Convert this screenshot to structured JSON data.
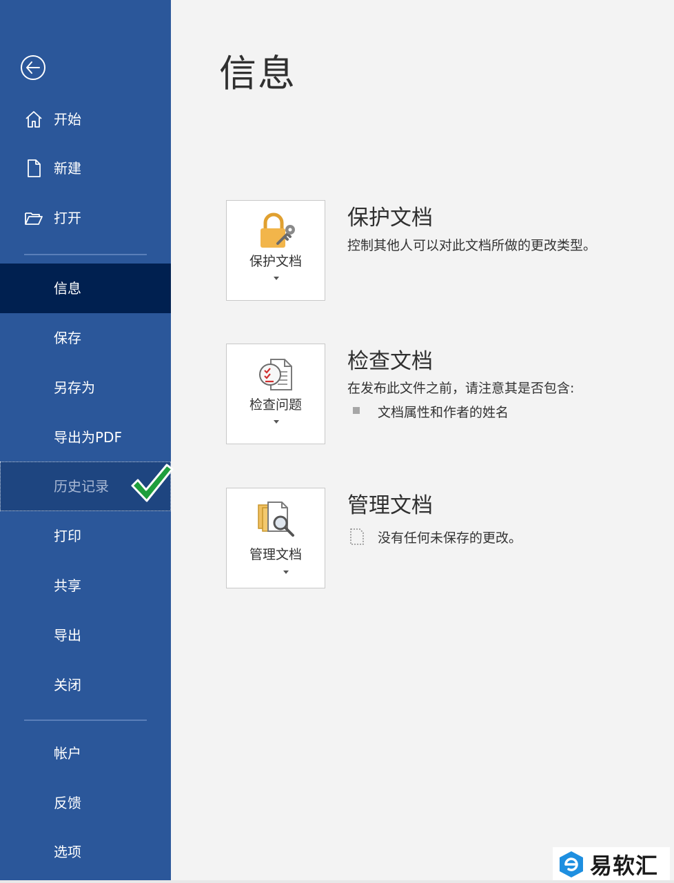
{
  "sidebar": {
    "top_items": [
      {
        "label": "开始",
        "icon": "home-icon"
      },
      {
        "label": "新建",
        "icon": "new-document-icon"
      },
      {
        "label": "打开",
        "icon": "open-folder-icon"
      }
    ],
    "items": [
      {
        "label": "信息",
        "state": "active"
      },
      {
        "label": "保存"
      },
      {
        "label": "另存为"
      },
      {
        "label": "导出为PDF"
      },
      {
        "label": "历史记录",
        "state": "hovered"
      },
      {
        "label": "打印"
      },
      {
        "label": "共享"
      },
      {
        "label": "导出"
      },
      {
        "label": "关闭"
      }
    ],
    "bottom_items": [
      {
        "label": "帐户"
      },
      {
        "label": "反馈"
      },
      {
        "label": "选项"
      }
    ]
  },
  "main": {
    "title": "信息",
    "sections": [
      {
        "button_label": "保护文档",
        "icon": "lock-key-icon",
        "title": "保护文档",
        "description": "控制其他人可以对此文档所做的更改类型。"
      },
      {
        "button_label": "检查问题",
        "icon": "inspect-document-icon",
        "title": "检查文档",
        "description": "在发布此文件之前，请注意其是否包含:",
        "bullets": [
          "文档属性和作者的姓名"
        ]
      },
      {
        "button_label": "管理文档",
        "icon": "manage-documents-icon",
        "title": "管理文档",
        "note": "没有任何未保存的更改。"
      }
    ]
  },
  "watermark": {
    "text": "易软汇"
  },
  "colors": {
    "sidebar": "#2b579a",
    "active": "#002050",
    "accent_check": "#1e9e3c"
  }
}
